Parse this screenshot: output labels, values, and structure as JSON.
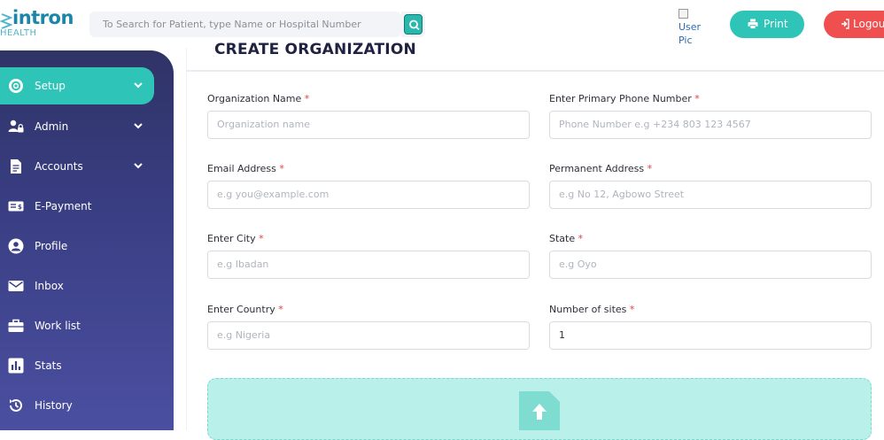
{
  "app": {
    "logo_text": "intron",
    "logo_sub": "HEALTH"
  },
  "header": {
    "search_placeholder": "To Search for Patient, type Name or Hospital Number",
    "userpic_line1": "User",
    "userpic_line2": "Pic",
    "print_label": "Print",
    "logout_label": "Logout"
  },
  "sidebar": {
    "items": [
      {
        "label": "Setup",
        "icon": "gear-icon",
        "active": true,
        "chevron": true
      },
      {
        "label": "Admin",
        "icon": "users-lock-icon",
        "active": false,
        "chevron": true
      },
      {
        "label": "Accounts",
        "icon": "document-icon",
        "active": false,
        "chevron": true
      },
      {
        "label": "E-Payment",
        "icon": "money-bill-icon",
        "active": false,
        "chevron": false
      },
      {
        "label": "Profile",
        "icon": "user-circle-icon",
        "active": false,
        "chevron": false
      },
      {
        "label": "Inbox",
        "icon": "envelope-icon",
        "active": false,
        "chevron": false
      },
      {
        "label": "Work list",
        "icon": "briefcase-icon",
        "active": false,
        "chevron": false
      },
      {
        "label": "Stats",
        "icon": "bar-chart-icon",
        "active": false,
        "chevron": false
      },
      {
        "label": "History",
        "icon": "history-icon",
        "active": false,
        "chevron": false
      }
    ]
  },
  "form": {
    "title": "CREATE ORGANIZATION",
    "required_mark": "*",
    "fields": [
      {
        "label": "Organization Name",
        "placeholder": "Organization name",
        "value": ""
      },
      {
        "label": "Enter Primary Phone Number",
        "placeholder": "Phone Number e.g +234 803 123 4567",
        "value": ""
      },
      {
        "label": "Email Address",
        "placeholder": "e.g you@example.com",
        "value": ""
      },
      {
        "label": "Permanent Address",
        "placeholder": "e.g No 12, Agbowo Street",
        "value": ""
      },
      {
        "label": "Enter City",
        "placeholder": "e.g Ibadan",
        "value": ""
      },
      {
        "label": "State",
        "placeholder": "e.g Oyo",
        "value": ""
      },
      {
        "label": "Enter Country",
        "placeholder": "e.g Nigeria",
        "value": ""
      },
      {
        "label": "Number of sites",
        "placeholder": "",
        "value": "1"
      }
    ]
  },
  "colors": {
    "accent": "#2fc4b8",
    "sidebar_top": "#2f3366",
    "sidebar_bottom": "#4b4fa0",
    "logout": "#f04f4f",
    "required": "#e53e3e",
    "upload_bg": "#b9f1ea"
  }
}
